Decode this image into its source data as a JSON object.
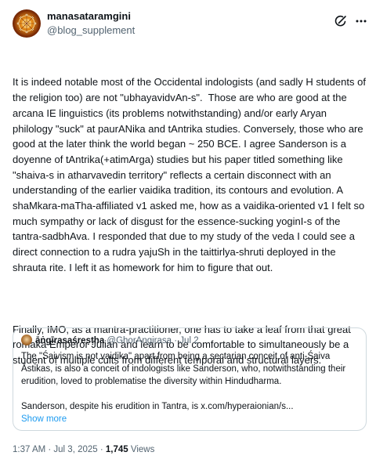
{
  "author": {
    "display_name": "manasataramgini",
    "handle": "@blog_supplement"
  },
  "icons": {
    "avatar": "mandala-avatar",
    "grok": "grok-icon",
    "more": "more-icon"
  },
  "post": {
    "paragraph_1": "It is indeed notable most of the Occidental indologists (and sadly H students of the religion too) are not \"ubhayavidvAn-s\".  Those are who are good at the arcana IE linguistics (its problems notwithstanding) and/or early Aryan philology \"suck\" at paurANika and tAntrika studies. Conversely, those who are good at the later think the world began ~ 250 BCE. I agree Sanderson is a doyenne of tAntrika(+atimArga) studies but his paper titled something like \"shaiva-s in atharvavedin territory\" reflects a certain disconnect with an understanding of the earlier vaidika tradition, its contours and evolution. A shaMkara-maTha-affiliated v1 asked me, how as a vaidika-oriented v1 I felt so much sympathy or lack of disgust for the essence-sucking yoginI-s of the tantra-sadbhAva. I responded that due to my study of the veda I could see a direct connection to a rudra yajuSh in the taittirlya-shruti deployed in the shrauta rite. I left it as homework for him to figure that out.",
    "paragraph_2": "Finally, IMO, as a mantra-practitioner, one has to take a leaf from that great romaka Emperor Julian and learn to be comfortable to simultaneously be a student of multiple cults from different temporal and structural layers."
  },
  "quote": {
    "display_name": "āṅgīrasaśreṣṭha",
    "handle": "@GhorAngirasa",
    "separator": " · ",
    "date": "Jul 2",
    "paragraph_1": "The \"Śaivism is not vaidika\" apart from being a sectarian conceit of anti-Śaiva Āstikas, is also a conceit of indologists like Sanderson, who, notwithstanding their erudition, loved to problematise the diversity within Hindudharma.",
    "paragraph_2": "Sanderson, despite his erudition in Tantra, is x.com/hyperaionian/s...",
    "show_more": "Show more"
  },
  "footer": {
    "time": "1:37 AM · Jul 3, 2025 · ",
    "views_count": "1,745",
    "views_label": " Views"
  }
}
